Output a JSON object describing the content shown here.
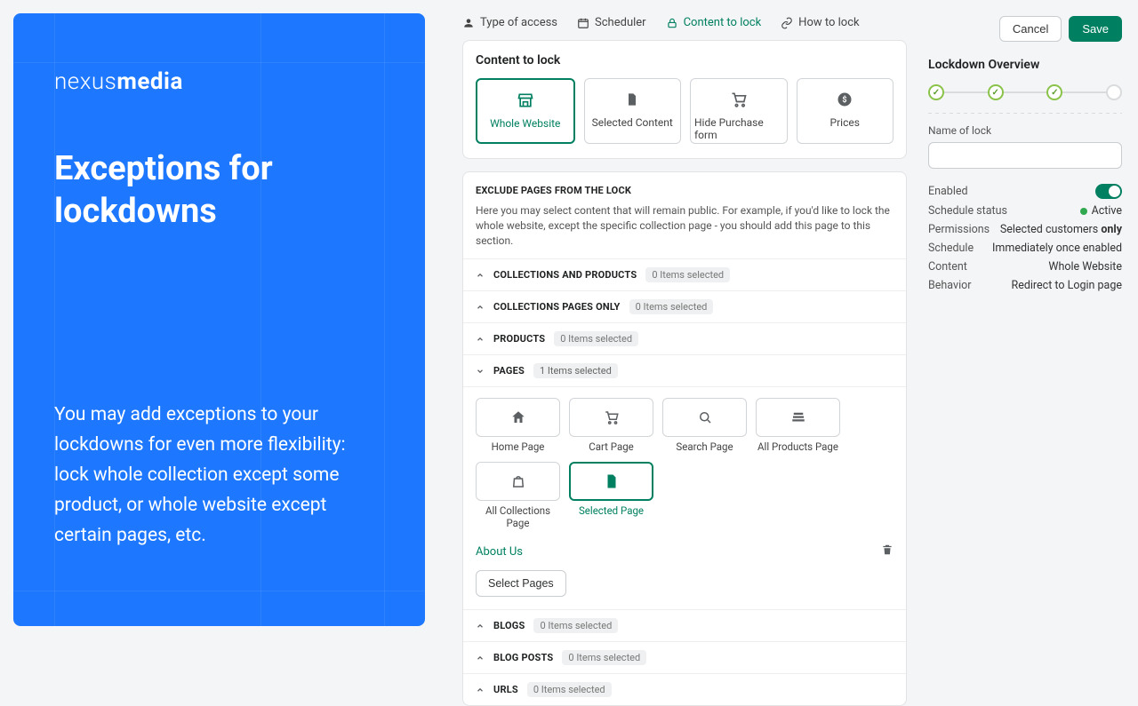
{
  "promo": {
    "logo_light": "nexus",
    "logo_bold": "media",
    "title": "Exceptions for lockdowns",
    "body": "You may add exceptions to your lockdowns for even more flexibility: lock whole collection except some product, or whole website except certain pages, etc."
  },
  "tabs": {
    "type_of_access": "Type of access",
    "scheduler": "Scheduler",
    "content_to_lock": "Content to lock",
    "how_to_lock": "How to lock"
  },
  "content_card": {
    "title": "Content to lock",
    "tiles": {
      "whole_website": "Whole Website",
      "selected_content": "Selected Content",
      "hide_purchase": "Hide Purchase form",
      "prices": "Prices"
    }
  },
  "exclude": {
    "title": "EXCLUDE PAGES FROM THE LOCK",
    "desc": "Here you may select content that will remain public. For example, if you'd like to lock the whole website, except the specific collection page - you should add this page to this section.",
    "zero_items": "0 Items selected",
    "one_item": "1 Items selected",
    "sections": {
      "collections_products": "COLLECTIONS AND PRODUCTS",
      "collections_pages": "COLLECTIONS PAGES ONLY",
      "products": "PRODUCTS",
      "pages": "PAGES",
      "blogs": "BLOGS",
      "blog_posts": "BLOG POSTS",
      "urls": "URLS"
    },
    "page_tiles": {
      "home": "Home Page",
      "cart": "Cart Page",
      "search": "Search Page",
      "all_products": "All Products Page",
      "all_collections": "All Collections Page",
      "selected_page": "Selected Page"
    },
    "linked_page": "About Us",
    "select_pages_btn": "Select Pages"
  },
  "side": {
    "cancel": "Cancel",
    "save": "Save",
    "overview_title": "Lockdown Overview",
    "name_label": "Name of lock",
    "name_value": "",
    "enabled_label": "Enabled",
    "rows": {
      "schedule_status_k": "Schedule status",
      "schedule_status_v": "Active",
      "permissions_k": "Permissions",
      "permissions_v_pre": "Selected customers ",
      "permissions_v_bold": "only",
      "schedule_k": "Schedule",
      "schedule_v": "Immediately once enabled",
      "content_k": "Content",
      "content_v": "Whole Website",
      "behavior_k": "Behavior",
      "behavior_v": "Redirect to Login page"
    }
  }
}
